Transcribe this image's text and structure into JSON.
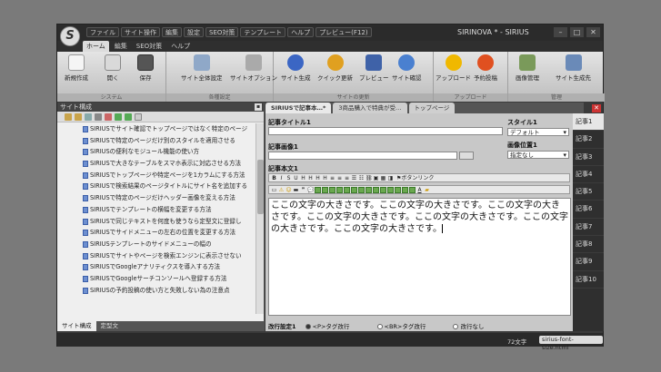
{
  "title": {
    "logo": "S",
    "menus": [
      "ファイル",
      "サイト操作",
      "編集",
      "設定",
      "SEO対策",
      "テンプレート",
      "ヘルプ",
      "プレビュー(F12)"
    ],
    "app": "SIRINOVA * - SIRIUS"
  },
  "ribbon_tabs": [
    "ホーム",
    "編集",
    "SEO対策",
    "ヘルプ"
  ],
  "groups": [
    {
      "label": "システム",
      "buttons": [
        "新規作成",
        "開く",
        "保存"
      ]
    },
    {
      "label": "各種設定",
      "buttons": [
        "サイト全体設定",
        "サイトオプション"
      ]
    },
    {
      "label": "サイトの更新",
      "buttons": [
        "サイト生成",
        "クイック更新",
        "プレビュー",
        "サイト確認"
      ]
    },
    {
      "label": "アップロード",
      "buttons": [
        "アップロード",
        "予約投稿"
      ]
    },
    {
      "label": "管理",
      "buttons": [
        "画像管理",
        "サイト生成先"
      ]
    }
  ],
  "left": {
    "title": "サイト構成",
    "items": [
      "SIRIUSでサイト確認でトップページではなく特定のページ",
      "SIRIUSで特定のページだけ別のスタイルを適用させる",
      "SIRIUSの便利なモジュール機能の使い方",
      "SIRIUSで大きなテーブルをスマホ表示に対応させる方法",
      "SIRIUSでトップページや特定ページを1カラムにする方法",
      "SIRIUSで検索結果のページタイトルにサイト名を追加する",
      "SIRIUSで特定のページだけヘッダー画像を変える方法",
      "SIRIUSでテンプレートの横幅を変更する方法",
      "SIRIUSで同じテキストを何度も使うなら定型文に登録し",
      "SIRIUSでサイドメニューの左右の位置を変更する方法",
      "SIRIUSテンプレートのサイドメニューの幅の",
      "SIRIUSでサイトやページを検索エンジンに表示させない",
      "SIRIUSでGoogleアナリティクスを導入する方法",
      "SIRIUSでGoogleサーチコンソールへ登録する方法",
      "SIRIUSの予約投稿の使い方と失敗しない為の注意点"
    ],
    "tabs": [
      "サイト構成",
      "定型文"
    ]
  },
  "doc_tabs": [
    "SIRIUSで記事本…*",
    "3商品購入で特典が受…",
    "トップページ"
  ],
  "editor": {
    "title_label": "記事タイトル1",
    "image_label": "記事画像1",
    "body_label": "記事本文1",
    "style_label": "スタイル1",
    "style_value": "デフォルト",
    "imgpos_label": "画像位置1",
    "imgpos_value": "指定なし",
    "button_link": "ボタンリンク",
    "body_text": "ここの文字の大きさです。ここの文字の大きさです。ここの文字の大きさです。ここの文字の大きさです。ここの文字の大きさです。ここの文字の大きさです。ここの文字の大きさです。",
    "break_label": "改行設定1",
    "break_options": [
      "<P>タグ改行",
      "<BR>タグ改行",
      "改行なし"
    ]
  },
  "articles": [
    "記事1",
    "記事2",
    "記事3",
    "記事4",
    "記事5",
    "記事6",
    "記事7",
    "記事8",
    "記事9",
    "記事10"
  ],
  "status": {
    "chars": "72文字",
    "tag": "sirius-font-size.html"
  }
}
